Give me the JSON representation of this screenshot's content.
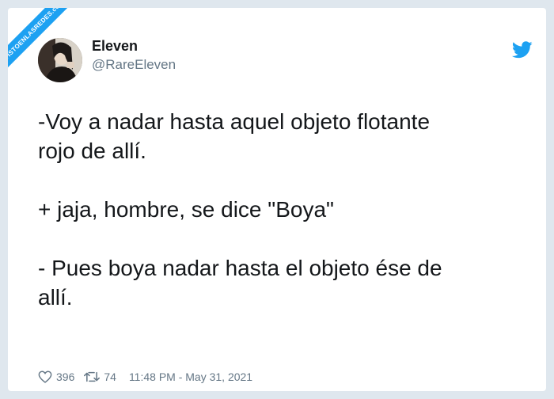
{
  "watermark": "VISTOENLASREDES.com",
  "author": {
    "name": "Eleven",
    "handle": "@RareEleven"
  },
  "tweet": {
    "lines": [
      "-Voy a nadar hasta aquel objeto flotante",
      "rojo de allí.",
      "",
      "+ jaja, hombre, se dice \"Boya\"",
      "",
      "- Pues boya nadar hasta el objeto ése de",
      "allí."
    ]
  },
  "stats": {
    "likes": "396",
    "retweets": "74",
    "timestamp": "11:48 PM - May 31, 2021"
  },
  "icons": {
    "brand": "twitter-bird-icon",
    "like": "heart-icon",
    "retweet": "retweet-icon"
  },
  "colors": {
    "brand": "#1da1f2",
    "text": "#14171a",
    "muted": "#657786"
  }
}
